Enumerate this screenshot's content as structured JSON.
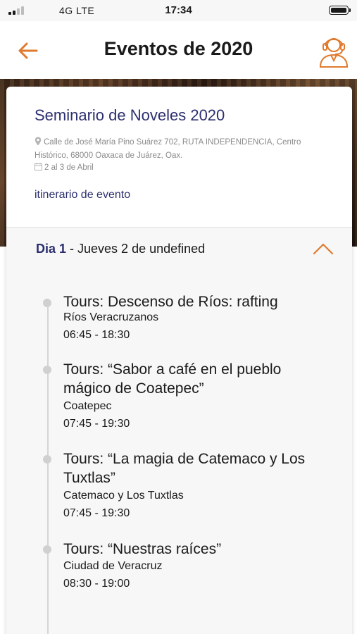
{
  "status_bar": {
    "network": "4G  LTE",
    "time": "17:34"
  },
  "header": {
    "title": "Eventos de 2020"
  },
  "event": {
    "title": "Seminario de Noveles 2020",
    "address": "Calle de José María Pino Suárez 702, RUTA INDEPENDENCIA, Centro Histórico, 68000 Oaxaca de Juárez, Oax.",
    "dates": "2 al 3 de Abril",
    "itinerary_link": "itinerario de evento"
  },
  "day": {
    "label_bold": "Dia 1",
    "label_rest": " - Jueves 2 de undefined"
  },
  "items": [
    {
      "title": "Tours: Descenso de Ríos: rafting",
      "place": "Ríos Veracruzanos",
      "time": "06:45 - 18:30"
    },
    {
      "title": "Tours: “Sabor a café en el pueblo mágico de Coatepec”",
      "place": "Coatepec",
      "time": "07:45 - 19:30"
    },
    {
      "title": "Tours: “La magia de Catemaco y Los Tuxtlas”",
      "place": "Catemaco y Los Tuxtlas",
      "time": "07:45 - 19:30"
    },
    {
      "title": "Tours: “Nuestras raíces”",
      "place": "Ciudad de Veracruz",
      "time": "08:30 - 19:00"
    }
  ],
  "colors": {
    "accent": "#e07a2e",
    "heading": "#2c2f6e",
    "muted": "#8a8a8a"
  },
  "icons": {
    "back": "arrow-left-icon",
    "agent": "support-agent-icon",
    "location": "map-pin-icon",
    "date": "calendar-icon",
    "toggle": "chevron-up-icon"
  }
}
